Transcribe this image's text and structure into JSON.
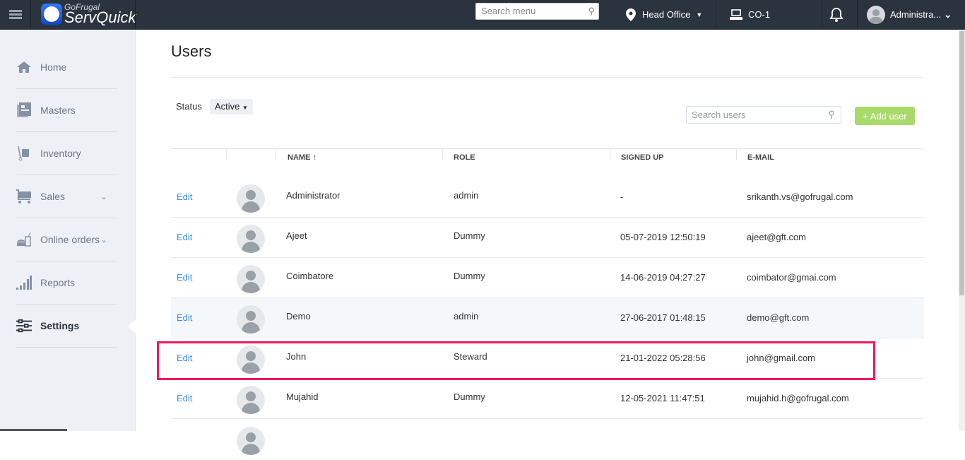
{
  "topbar": {
    "brand_small": "GoFrugal",
    "brand": "ServQuick",
    "search_placeholder": "Search menu",
    "location": "Head Office",
    "counter": "CO-1",
    "user": "Administra..."
  },
  "sidebar": {
    "items": [
      {
        "label": "Home"
      },
      {
        "label": "Masters"
      },
      {
        "label": "Inventory"
      },
      {
        "label": "Sales"
      },
      {
        "label": "Online orders"
      },
      {
        "label": "Reports"
      },
      {
        "label": "Settings"
      }
    ]
  },
  "page": {
    "title": "Users",
    "status_label": "Status",
    "status_value": "Active",
    "search_placeholder": "Search users",
    "add_user": "+ Add user"
  },
  "table": {
    "headers": {
      "name": "NAME ↑",
      "role": "ROLE",
      "signed_up": "SIGNED UP",
      "email": "E-MAIL"
    },
    "edit_label": "Edit",
    "rows": [
      {
        "name": "Administrator",
        "role": "admin",
        "signed_up": "-",
        "email": "srikanth.vs@gofrugal.com"
      },
      {
        "name": "Ajeet",
        "role": "Dummy",
        "signed_up": "05-07-2019 12:50:19",
        "email": "ajeet@gft.com"
      },
      {
        "name": "Coimbatore",
        "role": "Dummy",
        "signed_up": "14-06-2019 04:27:27",
        "email": "coimbator@gmai.com"
      },
      {
        "name": "Demo",
        "role": "admin",
        "signed_up": "27-06-2017 01:48:15",
        "email": "demo@gft.com"
      },
      {
        "name": "John",
        "role": "Steward",
        "signed_up": "21-01-2022 05:28:56",
        "email": "john@gmail.com"
      },
      {
        "name": "Mujahid",
        "role": "Dummy",
        "signed_up": "12-05-2021 11:47:51",
        "email": "mujahid.h@gofrugal.com"
      }
    ]
  }
}
